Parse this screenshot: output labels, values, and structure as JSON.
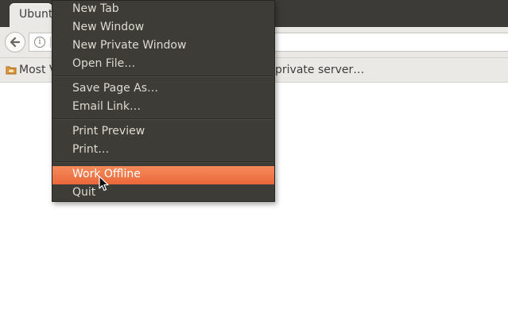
{
  "window": {
    "tab_title": "Ubuntu"
  },
  "bookmarks": {
    "items": [
      {
        "label": "Most Visited"
      },
      {
        "label": "private server…"
      }
    ]
  },
  "file_menu": {
    "items": [
      {
        "label": "New Tab"
      },
      {
        "label": "New Window"
      },
      {
        "label": "New Private Window"
      },
      {
        "label": "Open File…"
      },
      {
        "label": "Save Page As…"
      },
      {
        "label": "Email Link…"
      },
      {
        "label": "Print Preview"
      },
      {
        "label": "Print…"
      },
      {
        "label": "Work Offline",
        "highlighted": true
      },
      {
        "label": "Quit"
      }
    ]
  },
  "colors": {
    "menu_background": "#3d3c37",
    "menu_text": "#dfdbd2",
    "highlight": "#f07746",
    "titlebar": "#3c3b37",
    "toolbar": "#ebe9e6"
  },
  "icons": {
    "back": "back-arrow-icon",
    "site_info": "info-icon",
    "bookmark_folder": "folder-icon",
    "pointer": "mouse-pointer-icon"
  }
}
